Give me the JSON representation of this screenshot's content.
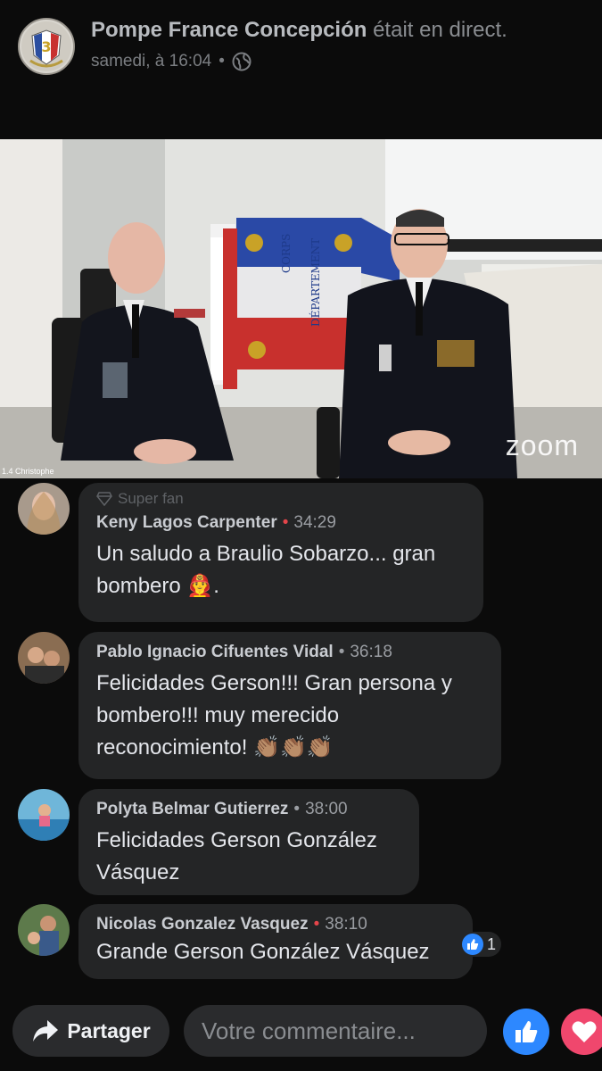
{
  "header": {
    "page_name": "Pompe France Concepción",
    "status": "était en direct.",
    "timestamp": "samedi, à 16:04",
    "separator": "•",
    "audience_icon": "globe-icon"
  },
  "video": {
    "participant_label": "1.4 Christophe",
    "watermark": "zoom",
    "flag_text": "CORPS DÉPARTEMENT"
  },
  "comments": [
    {
      "badge": "Super fan",
      "author": "Keny Lagos Carpenter",
      "time": "34:29",
      "text_line1": "Un saludo a Braulio Sobarzo... gran",
      "text_line2": "bombero 👨‍🚒."
    },
    {
      "author": "Pablo Ignacio Cifuentes Vidal",
      "time": "36:18",
      "text_line1": "Felicidades Gerson!!! Gran persona y",
      "text_line2": "bombero!!! muy merecido",
      "text_line3": "reconocimiento! 👏🏽👏🏽👏🏽"
    },
    {
      "author": "Polyta Belmar Gutierrez",
      "time": "38:00",
      "text_line1": "Felicidades Gerson González",
      "text_line2": "Vásquez"
    },
    {
      "author": "Nicolas Gonzalez Vasquez",
      "time": "38:10",
      "text_line1": "Grande Gerson González Vásquez",
      "reaction_count": "1",
      "reaction_icon": "like-icon"
    }
  ],
  "bottom": {
    "share_label": "Partager",
    "comment_placeholder": "Votre commentaire..."
  },
  "colors": {
    "background": "#0b0b0b",
    "bubble": "#242526",
    "like_blue": "#2d88ff",
    "love_pink": "#f0476d",
    "live_dot": "#e4454a"
  }
}
